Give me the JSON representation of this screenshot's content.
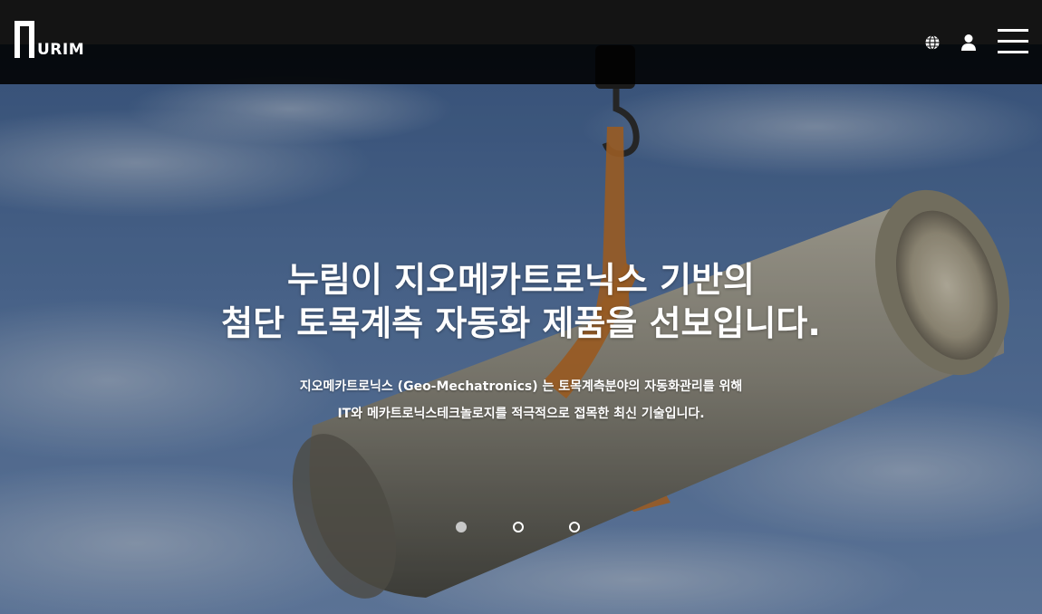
{
  "header": {
    "logo_text": "URIM",
    "icons": [
      "globe-icon",
      "user-icon",
      "hamburger-menu-icon"
    ]
  },
  "hero": {
    "title_line1": "누림이 지오메카트로닉스 기반의",
    "title_line2": "첨단 토목계측 자동화 제품을 선보입니다.",
    "desc_line1": "지오메카트로닉스 (Geo-Mechatronics) 는 토목계측분야의 자동화관리를 위해",
    "desc_line2": "IT와 메카트로닉스테크놀로지를 적극적으로 접목한 최신 기술입니다."
  },
  "slider": {
    "slide_count": 3,
    "active_index": 0
  },
  "colors": {
    "header_bg": "#141414",
    "text": "#ffffff",
    "dot_active": "#c8c8c8"
  }
}
